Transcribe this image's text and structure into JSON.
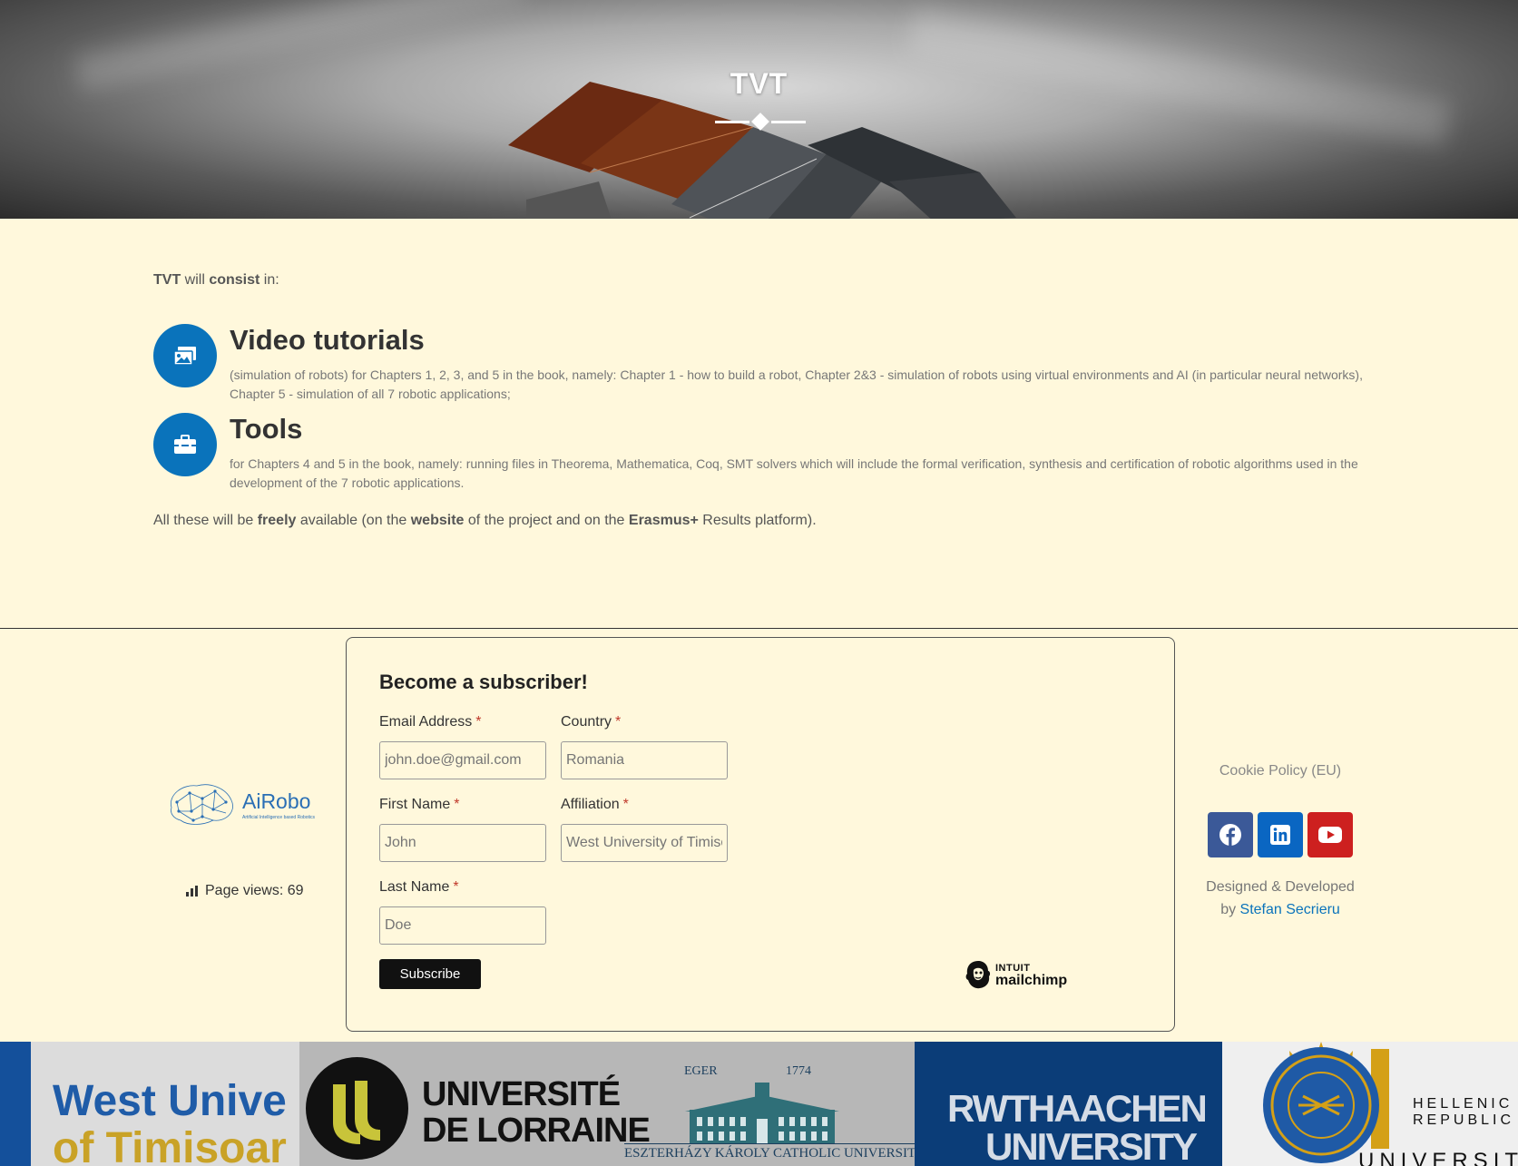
{
  "hero": {
    "title": "TVT"
  },
  "intro": {
    "part1": "TVT",
    "part2": " will ",
    "part3": "consist",
    "part4": " in:"
  },
  "features": [
    {
      "icon": "images-icon",
      "title": "Video tutorials",
      "text": "(simulation of robots) for Chapters 1, 2, 3, and 5 in the book, namely: Chapter 1 - how to build a robot, Chapter 2&3 - simulation of robots using virtual environments and AI (in particular neural networks), Chapter 5 - simulation of all 7 robotic applications;"
    },
    {
      "icon": "toolbox-icon",
      "title": "Tools",
      "text": "for Chapters 4 and 5 in the book, namely: running files in Theorema, Mathematica, Coq, SMT solvers which will include the formal verification, synthesis and certification of robotic algorithms used in the development of the 7 robotic applications."
    }
  ],
  "outro": {
    "p1": "All these will be ",
    "b1": "freely",
    "p2": " available (on the ",
    "b2": "website",
    "p3": " of the project and on the ",
    "b3": "Erasmus+",
    "p4": " Results platform)."
  },
  "footer_left": {
    "logo_text": "AiRobo",
    "logo_sub": "Artificial Intelligence based Robotics",
    "page_views": "Page views: 69"
  },
  "form": {
    "title": "Become a subscriber!",
    "email": {
      "label": "Email Address",
      "placeholder": "john.doe@gmail.com"
    },
    "country": {
      "label": "Country",
      "placeholder": "Romania"
    },
    "first_name": {
      "label": "First Name",
      "placeholder": "John"
    },
    "affiliation": {
      "label": "Affiliation",
      "placeholder": "West University of Timisoara"
    },
    "last_name": {
      "label": "Last Name",
      "placeholder": "Doe"
    },
    "required_mark": "*",
    "subscribe_label": "Subscribe",
    "badge_top": "INTUIT",
    "badge_main": "mailchimp"
  },
  "footer_right": {
    "cookie": "Cookie Policy (EU)",
    "socials": [
      "facebook-icon",
      "linkedin-icon",
      "youtube-icon"
    ],
    "credits_line1": "Designed & Developed",
    "credits_by": "by ",
    "credits_name": "Stefan Secrieru"
  },
  "partners": {
    "wvt_line1": "West Unive",
    "wvt_line2": "of Timisoar",
    "ul_line1": "UNIVERSITÉ",
    "ul_line2": "DE LORRAINE",
    "ekc_city": "EGER",
    "ekc_year": "1774",
    "ekc_name": "ESZTERHÁZY KÁROLY CATHOLIC UNIVERSITY",
    "rwth_line1": "RWTHAACHEN",
    "rwth_line2": "UNIVERSITY",
    "hel_line1": "HELLENIC",
    "hel_line2": "REPUBLIC",
    "hel_line3": "UNIVERSITY"
  },
  "colors": {
    "accent": "#0a73bb",
    "background": "#fff8dc",
    "facebook": "#3b5998",
    "linkedin": "#0a66c2",
    "youtube": "#cd201f"
  }
}
